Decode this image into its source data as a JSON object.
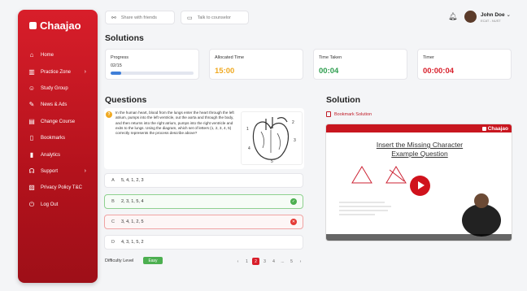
{
  "brand": {
    "name": "Chaajao",
    "color": "#d81e2a"
  },
  "sidebar": {
    "items": [
      {
        "label": "Home",
        "icon": "home-icon",
        "has_children": false
      },
      {
        "label": "Practice Zone",
        "icon": "practice-icon",
        "has_children": true
      },
      {
        "label": "Study Group",
        "icon": "group-icon",
        "has_children": false
      },
      {
        "label": "News & Ads",
        "icon": "news-icon",
        "has_children": false
      },
      {
        "label": "Change Course",
        "icon": "course-icon",
        "has_children": false
      },
      {
        "label": "Bookmarks",
        "icon": "bookmark-icon",
        "has_children": false
      },
      {
        "label": "Analytics",
        "icon": "analytics-icon",
        "has_children": false
      },
      {
        "label": "Support",
        "icon": "support-icon",
        "has_children": true
      },
      {
        "label": "Privacy Policy T&C",
        "icon": "policy-icon",
        "has_children": false
      },
      {
        "label": "Log Out",
        "icon": "logout-icon",
        "has_children": false
      }
    ]
  },
  "topbar": {
    "share_label": "Share with friends",
    "counselor_label": "Talk to counselor",
    "user_name": "John Doe",
    "user_sub": "ECAT - NUST"
  },
  "solutions": {
    "title": "Solutions",
    "progress_label": "Progress",
    "progress_value": "02/15",
    "progress_fraction": 0.13,
    "allocated_label": "Allocated Time",
    "allocated_value": "15:00",
    "allocated_color": "#f0a921",
    "taken_label": "Time Taken",
    "taken_value": "00:04",
    "taken_color": "#2e9e4f",
    "timer_label": "Timer",
    "timer_value": "00:00:04",
    "timer_color": "#d81e2a"
  },
  "questions": {
    "title": "Questions",
    "badge": "?",
    "text": "In the human heart, blood from the lungs enter the heart through the left atrium, pumps into the left ventricle, out the aorta and through the body, and then returns into the right atrium, pumps into the right ventricle and exits to the lungs. Using the diagram, which set of letters (1, 2, 3, 4, 5) correctly represents the process describe above?",
    "options": [
      {
        "key": "A",
        "text": "5, 4, 1, 2, 3",
        "state": "none"
      },
      {
        "key": "B",
        "text": "2, 3, 1, 5, 4",
        "state": "correct"
      },
      {
        "key": "C",
        "text": "3, 4, 1, 2, 5",
        "state": "wrong"
      },
      {
        "key": "D",
        "text": "4, 3, 1, 5, 2",
        "state": "none"
      }
    ],
    "difficulty_label": "Difficulty Level",
    "difficulty_value": "Easy",
    "pager": [
      "‹",
      "1",
      "2",
      "3",
      "4",
      "...",
      "5",
      "›"
    ],
    "pager_current": "2"
  },
  "solution": {
    "title": "Solution",
    "bookmark_label": "Bookmark Solution",
    "video_title_line1": "Insert the Missing Character",
    "video_title_line2": "Example Question"
  }
}
